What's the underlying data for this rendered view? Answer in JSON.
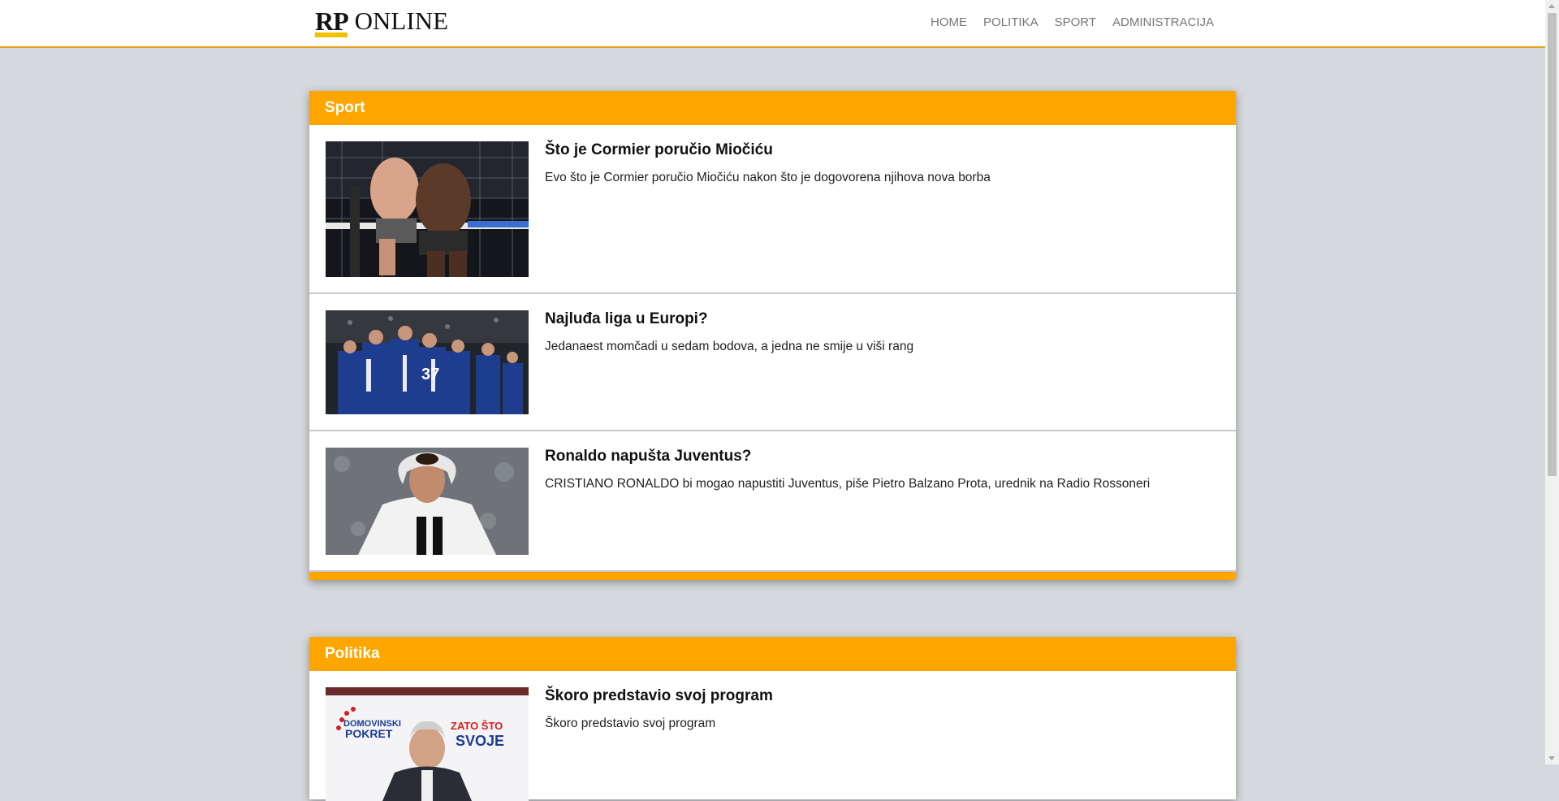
{
  "header": {
    "logo_rp": "RP",
    "logo_online": "ONLINE",
    "nav": [
      "HOME",
      "POLITIKA",
      "SPORT",
      "ADMINISTRACIJA"
    ]
  },
  "colors": {
    "accent": "#ffa500",
    "background": "#d5d8dc",
    "logo_yellow": "#f2c200"
  },
  "sections": [
    {
      "title": "Sport",
      "articles": [
        {
          "title": "Što je Cormier poručio Miočiću",
          "summary": "Evo što je Cormier poručio Miočiću nakon što je dogovorena njihova nova borba",
          "image": "mma-fight-photo"
        },
        {
          "title": "Najluđa liga u Europi?",
          "summary": "Jedanaest momčadi u sedam bodova, a jedna ne smije u viši rang",
          "image": "football-team-celebration-photo"
        },
        {
          "title": "Ronaldo napušta Juventus?",
          "summary": "CRISTIANO RONALDO bi mogao napustiti Juventus, piše Pietro Balzano Prota, urednik na Radio Rossoneri",
          "image": "ronaldo-photo"
        }
      ]
    },
    {
      "title": "Politika",
      "articles": [
        {
          "title": "Škoro predstavio svoj program",
          "summary": "Škoro predstavio svoj program",
          "image": "politician-speech-photo"
        }
      ]
    }
  ]
}
